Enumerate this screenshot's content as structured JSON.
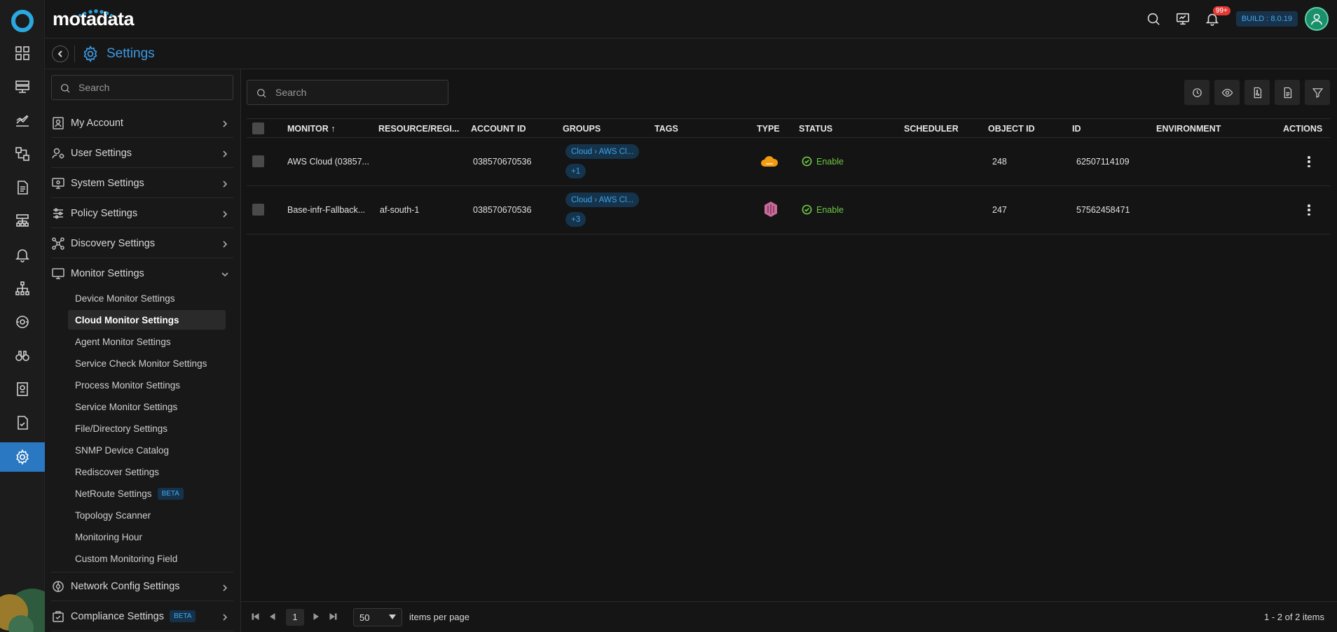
{
  "brand": {
    "name": "motadata"
  },
  "header": {
    "notification_count": "99+",
    "build": "BUILD : 8.0.19"
  },
  "breadcrumb": {
    "title": "Settings"
  },
  "sidebar": {
    "search_placeholder": "Search",
    "categories": [
      {
        "label": "My Account",
        "icon": "user-card-icon"
      },
      {
        "label": "User Settings",
        "icon": "user-gear-icon"
      },
      {
        "label": "System Settings",
        "icon": "monitor-gear-icon"
      },
      {
        "label": "Policy Settings",
        "icon": "sliders-icon"
      },
      {
        "label": "Discovery Settings",
        "icon": "network-discovery-icon"
      },
      {
        "label": "Monitor Settings",
        "icon": "monitor-icon"
      },
      {
        "label": "Network Config Settings",
        "icon": "network-config-icon"
      },
      {
        "label": "Compliance Settings",
        "icon": "compliance-icon",
        "badge": "BETA"
      }
    ],
    "monitor_sub_items": [
      {
        "label": "Device Monitor Settings"
      },
      {
        "label": "Cloud Monitor Settings",
        "active": true
      },
      {
        "label": "Agent Monitor Settings"
      },
      {
        "label": "Service Check Monitor Settings"
      },
      {
        "label": "Process Monitor Settings"
      },
      {
        "label": "Service Monitor Settings"
      },
      {
        "label": "File/Directory Settings"
      },
      {
        "label": "SNMP Device Catalog"
      },
      {
        "label": "Rediscover Settings"
      },
      {
        "label": "NetRoute Settings",
        "badge": "BETA"
      },
      {
        "label": "Topology Scanner"
      },
      {
        "label": "Monitoring Hour"
      },
      {
        "label": "Custom Monitoring Field"
      }
    ]
  },
  "grid": {
    "search_placeholder": "Search",
    "columns": {
      "monitor": "MONITOR",
      "resource_region": "RESOURCE/REGI...",
      "account_id": "ACCOUNT ID",
      "groups": "GROUPS",
      "tags": "TAGS",
      "type": "TYPE",
      "status": "STATUS",
      "scheduler": "SCHEDULER",
      "object_id": "OBJECT ID",
      "id": "ID",
      "environment": "ENVIRONMENT",
      "actions": "ACTIONS"
    },
    "sort_indicator": "↑",
    "rows": [
      {
        "monitor": "AWS Cloud (03857...",
        "resource_region": "",
        "account_id": "038570670536",
        "group_chip": "Cloud › AWS Cl...",
        "group_more": "+1",
        "type_icon": "aws-cloud-icon",
        "status": "Enable",
        "object_id": "248",
        "id": "62507114109"
      },
      {
        "monitor": "Base-infr-Fallback...",
        "resource_region": "af-south-1",
        "account_id": "038570670536",
        "group_chip": "Cloud › AWS Cl...",
        "group_more": "+3",
        "type_icon": "aws-ecs-icon",
        "status": "Enable",
        "object_id": "247",
        "id": "57562458471"
      }
    ]
  },
  "pager": {
    "current_page": "1",
    "page_size": "50",
    "items_per_page_label": "items per page",
    "count_label": "1 - 2 of 2 items"
  },
  "colors": {
    "accent": "#3d9ae4",
    "status_enable": "#6ec745",
    "chip_bg": "#15334a",
    "aws_orange": "#f39c12",
    "ecs_pink": "#c86b9a"
  }
}
